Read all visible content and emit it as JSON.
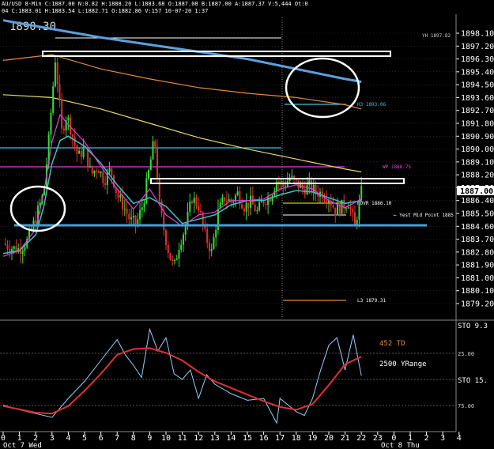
{
  "header": {
    "line1": "AU/USD  8-Min  C:1887.00  N:0.82  H:1888.20  L:1883.68  O:1887.08  B:1887.00  A:1887.37  V:5,444  Ot:0",
    "line2": "04  C:1883.01  H:1883.54  L:1882.71  O:1882.86  V:157  10-07-20  1:37",
    "big_price": "1890.30"
  },
  "colors": {
    "background": "#000000",
    "grid": "#3a3a3a",
    "axis_text": "#ffffff",
    "blue_ma": "#5aa0e0",
    "orange_ma": "#e08a3a",
    "yellow_ma": "#e6d86a",
    "cyan_ma": "#3fc0c0",
    "magenta_ma": "#e040e0",
    "up_candle": "#30e030",
    "down_candle": "#e03030",
    "sto_fast": "#8fd0ff",
    "sto_slow": "#e03030"
  },
  "price_axis": {
    "ticks": [
      "1898.10",
      "1897.20",
      "1896.30",
      "1895.40",
      "1894.50",
      "1893.60",
      "1892.70",
      "1891.80",
      "1890.90",
      "1890.00",
      "1889.10",
      "1888.20",
      "1887.30",
      "1886.40",
      "1885.50",
      "1884.60",
      "1883.70",
      "1882.80",
      "1881.90",
      "1881.00",
      "1880.10",
      "1879.20"
    ],
    "current": "1887.00"
  },
  "levels": {
    "yh": "YH 1897.82",
    "h3": "H3 1893.06",
    "wp": "WP 1888.75",
    "rovr": "ROVR 1886.10",
    "yest_mid": "← Yest Mid Point 1885",
    "l3": "L3 1879.31"
  },
  "sto_panel": {
    "label_top": "STO  9.3",
    "label_mid": "STO  15.",
    "level_25": "25.00",
    "level_75": "75.00",
    "text_td": "452 TD",
    "text_yrange": "2500 YRange"
  },
  "time_axis": {
    "hours": [
      "0",
      "1",
      "2",
      "3",
      "4",
      "5",
      "6",
      "7",
      "8",
      "9",
      "10",
      "11",
      "12",
      "13",
      "14",
      "15",
      "16",
      "17",
      "18",
      "19",
      "20",
      "21",
      "22",
      "23",
      "0",
      "1",
      "2",
      "3",
      "4"
    ],
    "day1": "Oct 7 Wed",
    "day2": "Oct 8 Thu"
  },
  "chart_data": {
    "type": "line",
    "ylim": [
      1878.8,
      1899.0
    ],
    "x_unit": "hour",
    "price_close": [
      [
        0,
        1883.4
      ],
      [
        0.5,
        1883.1
      ],
      [
        1,
        1883.0
      ],
      [
        1.5,
        1883.6
      ],
      [
        2,
        1885.2
      ],
      [
        2.5,
        1887.0
      ],
      [
        2.8,
        1890.6
      ],
      [
        3.0,
        1893.5
      ],
      [
        3.2,
        1896.3
      ],
      [
        3.4,
        1894.0
      ],
      [
        3.6,
        1891.2
      ],
      [
        3.9,
        1892.4
      ],
      [
        4.2,
        1891.2
      ],
      [
        4.6,
        1889.4
      ],
      [
        5.0,
        1890.1
      ],
      [
        5.4,
        1888.2
      ],
      [
        5.8,
        1888.8
      ],
      [
        6.2,
        1887.8
      ],
      [
        6.6,
        1888.6
      ],
      [
        7.0,
        1886.8
      ],
      [
        7.4,
        1886.0
      ],
      [
        7.8,
        1885.0
      ],
      [
        8.2,
        1884.8
      ],
      [
        8.6,
        1886.2
      ],
      [
        9.0,
        1888.8
      ],
      [
        9.3,
        1890.8
      ],
      [
        9.6,
        1886.0
      ],
      [
        9.9,
        1884.2
      ],
      [
        10.2,
        1882.6
      ],
      [
        10.5,
        1881.7
      ],
      [
        10.8,
        1883.3
      ],
      [
        11.2,
        1884.6
      ],
      [
        11.6,
        1886.6
      ],
      [
        12.0,
        1886.0
      ],
      [
        12.4,
        1884.0
      ],
      [
        12.8,
        1882.8
      ],
      [
        13.2,
        1885.6
      ],
      [
        13.6,
        1886.6
      ],
      [
        14.0,
        1886.3
      ],
      [
        14.4,
        1886.9
      ],
      [
        14.8,
        1886.0
      ],
      [
        15.2,
        1886.3
      ],
      [
        15.6,
        1885.6
      ],
      [
        16.0,
        1886.4
      ],
      [
        16.4,
        1886.7
      ],
      [
        16.8,
        1887.8
      ],
      [
        17.2,
        1887.4
      ],
      [
        17.6,
        1888.0
      ],
      [
        18.0,
        1887.6
      ],
      [
        18.4,
        1887.2
      ],
      [
        18.8,
        1887.4
      ],
      [
        19.2,
        1887.0
      ],
      [
        19.6,
        1886.9
      ],
      [
        20.0,
        1886.6
      ],
      [
        20.4,
        1885.7
      ],
      [
        20.8,
        1886.0
      ],
      [
        21.2,
        1886.3
      ],
      [
        21.6,
        1884.6
      ],
      [
        22.0,
        1887.0
      ]
    ],
    "ma_blue": [
      [
        0,
        1899.0
      ],
      [
        3,
        1898.4
      ],
      [
        6,
        1897.8
      ],
      [
        9,
        1897.3
      ],
      [
        12,
        1896.8
      ],
      [
        15,
        1896.3
      ],
      [
        18,
        1895.6
      ],
      [
        21,
        1894.9
      ],
      [
        22,
        1894.7
      ]
    ],
    "ma_orange": [
      [
        0,
        1896.2
      ],
      [
        3,
        1896.6
      ],
      [
        6,
        1895.6
      ],
      [
        9,
        1894.9
      ],
      [
        12,
        1894.3
      ],
      [
        15,
        1893.9
      ],
      [
        18,
        1893.6
      ],
      [
        21,
        1893.1
      ],
      [
        22,
        1892.8
      ]
    ],
    "ma_yellow": [
      [
        0,
        1893.8
      ],
      [
        3,
        1893.6
      ],
      [
        6,
        1892.8
      ],
      [
        9,
        1891.8
      ],
      [
        12,
        1890.8
      ],
      [
        15,
        1890.0
      ],
      [
        18,
        1889.3
      ],
      [
        21,
        1888.6
      ],
      [
        22,
        1888.4
      ]
    ],
    "ma_cyan": [
      [
        0,
        1882.7
      ],
      [
        1,
        1882.9
      ],
      [
        2,
        1884.0
      ],
      [
        2.5,
        1886.0
      ],
      [
        3,
        1889.0
      ],
      [
        3.5,
        1890.6
      ],
      [
        4,
        1890.9
      ],
      [
        5,
        1890.2
      ],
      [
        6,
        1889.0
      ],
      [
        7,
        1887.5
      ],
      [
        8,
        1886.2
      ],
      [
        9,
        1886.6
      ],
      [
        10,
        1886.0
      ],
      [
        11,
        1884.8
      ],
      [
        12,
        1885.1
      ],
      [
        13,
        1885.4
      ],
      [
        14,
        1886.1
      ],
      [
        15,
        1886.4
      ],
      [
        16,
        1886.4
      ],
      [
        17,
        1886.8
      ],
      [
        18,
        1887.1
      ],
      [
        19,
        1887.0
      ],
      [
        20,
        1886.6
      ],
      [
        21,
        1886.2
      ],
      [
        22,
        1886.4
      ]
    ],
    "ma_magenta": [
      [
        0,
        1882.5
      ],
      [
        1,
        1882.9
      ],
      [
        2,
        1884.4
      ],
      [
        2.5,
        1887.0
      ],
      [
        3,
        1890.5
      ],
      [
        3.5,
        1892.4
      ],
      [
        4,
        1891.7
      ],
      [
        5,
        1890.5
      ],
      [
        6,
        1888.8
      ],
      [
        7,
        1887.2
      ],
      [
        8,
        1885.8
      ],
      [
        9,
        1887.2
      ],
      [
        10,
        1885.4
      ],
      [
        11,
        1884.6
      ],
      [
        12,
        1885.4
      ],
      [
        13,
        1885.6
      ],
      [
        14,
        1886.4
      ],
      [
        15,
        1886.4
      ],
      [
        16,
        1886.5
      ],
      [
        17,
        1887.2
      ],
      [
        18,
        1887.5
      ],
      [
        19,
        1887.2
      ],
      [
        20,
        1886.4
      ],
      [
        21,
        1885.9
      ],
      [
        22,
        1886.5
      ]
    ],
    "sto_fast": [
      [
        0,
        77
      ],
      [
        1,
        82
      ],
      [
        2,
        86
      ],
      [
        3,
        90
      ],
      [
        4,
        70
      ],
      [
        5,
        52
      ],
      [
        6,
        30
      ],
      [
        7,
        8
      ],
      [
        7.5,
        24
      ],
      [
        8,
        35
      ],
      [
        8.5,
        48
      ],
      [
        9,
        -3
      ],
      [
        9.5,
        20
      ],
      [
        10,
        6
      ],
      [
        10.5,
        44
      ],
      [
        11,
        50
      ],
      [
        11.5,
        40
      ],
      [
        12,
        70
      ],
      [
        12.5,
        45
      ],
      [
        13,
        55
      ],
      [
        14,
        65
      ],
      [
        15,
        72
      ],
      [
        16,
        70
      ],
      [
        16.8,
        96
      ],
      [
        17,
        70
      ],
      [
        18,
        84
      ],
      [
        18.5,
        88
      ],
      [
        19,
        70
      ],
      [
        19.5,
        40
      ],
      [
        20,
        14
      ],
      [
        20.5,
        6
      ],
      [
        21,
        40
      ],
      [
        21.5,
        3
      ],
      [
        22,
        46
      ]
    ],
    "sto_slow": [
      [
        0,
        78
      ],
      [
        2,
        85
      ],
      [
        3,
        86
      ],
      [
        4,
        78
      ],
      [
        5,
        62
      ],
      [
        6,
        44
      ],
      [
        7,
        24
      ],
      [
        8,
        18
      ],
      [
        9,
        17
      ],
      [
        10,
        22
      ],
      [
        11,
        30
      ],
      [
        12,
        42
      ],
      [
        13,
        52
      ],
      [
        14,
        59
      ],
      [
        15,
        66
      ],
      [
        16,
        73
      ],
      [
        17,
        79
      ],
      [
        18,
        82
      ],
      [
        19,
        76
      ],
      [
        20,
        56
      ],
      [
        21,
        34
      ],
      [
        22,
        26
      ]
    ]
  }
}
